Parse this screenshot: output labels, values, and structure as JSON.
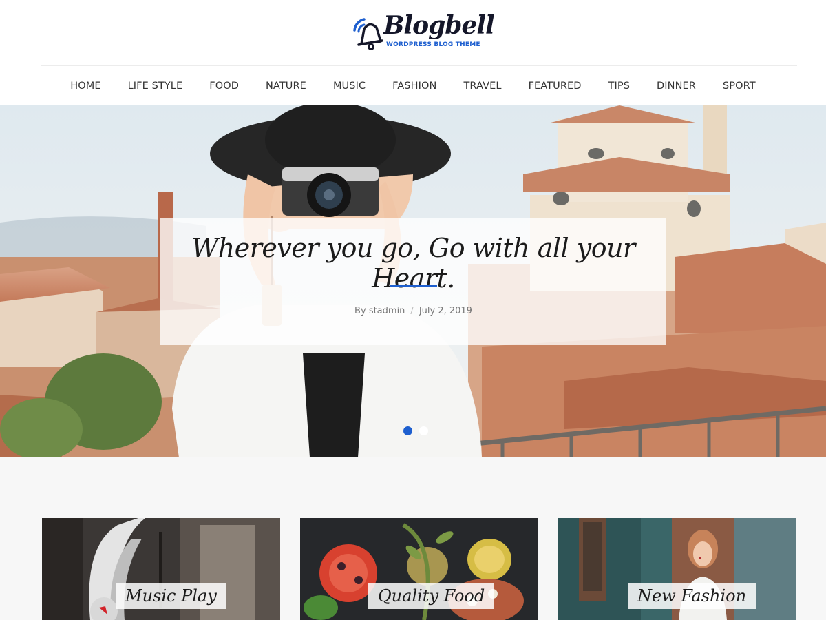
{
  "site": {
    "logo_text": "Blogbell",
    "logo_tagline": "WORDPRESS BLOG THEME"
  },
  "nav": {
    "items": [
      {
        "label": "HOME"
      },
      {
        "label": "LIFE STYLE"
      },
      {
        "label": "FOOD"
      },
      {
        "label": "NATURE"
      },
      {
        "label": "MUSIC"
      },
      {
        "label": "FASHION"
      },
      {
        "label": "TRAVEL"
      },
      {
        "label": "FEATURED"
      },
      {
        "label": "TIPS"
      },
      {
        "label": "DINNER"
      },
      {
        "label": "SPORT"
      }
    ]
  },
  "hero": {
    "title": "Wherever you go, Go with all your Heart.",
    "author_prefix": "By",
    "author": "stadmin",
    "separator": "/",
    "date": "July 2, 2019",
    "slides_total": 2,
    "active_slide": 1
  },
  "featured": {
    "cards": [
      {
        "label": "Music Play"
      },
      {
        "label": "Quality Food"
      },
      {
        "label": "New Fashion"
      }
    ]
  },
  "colors": {
    "accent": "#1e5fcf",
    "text_dark": "#15172a",
    "section_bg": "#f7f7f7"
  },
  "icons": {
    "logo": "bell-icon"
  }
}
